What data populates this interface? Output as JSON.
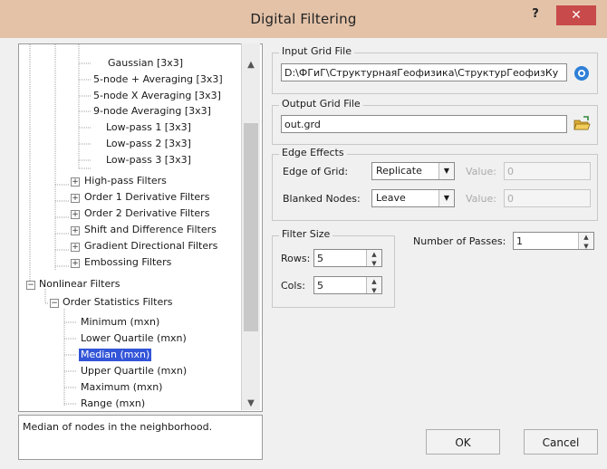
{
  "window": {
    "title": "Digital Filtering",
    "help_label": "?",
    "close_label": "✕"
  },
  "tree": {
    "items": [
      {
        "label": "Gaussian [3x3]"
      },
      {
        "label": "5-node + Averaging [3x3]"
      },
      {
        "label": "5-node X Averaging [3x3]"
      },
      {
        "label": "9-node Averaging [3x3]"
      },
      {
        "label": "Low-pass 1 [3x3]"
      },
      {
        "label": "Low-pass 2 [3x3]"
      },
      {
        "label": "Low-pass 3 [3x3]"
      },
      {
        "label": "High-pass Filters"
      },
      {
        "label": "Order 1 Derivative Filters"
      },
      {
        "label": "Order 2 Derivative Filters"
      },
      {
        "label": "Shift and Difference Filters"
      },
      {
        "label": "Gradient Directional Filters"
      },
      {
        "label": "Embossing Filters"
      },
      {
        "label": "Nonlinear Filters"
      },
      {
        "label": "Order Statistics Filters"
      },
      {
        "label": "Minimum (mxn)"
      },
      {
        "label": "Lower Quartile (mxn)"
      },
      {
        "label": "Median (mxn)"
      },
      {
        "label": "Upper Quartile (mxn)"
      },
      {
        "label": "Maximum (mxn)"
      },
      {
        "label": "Range (mxn)"
      }
    ],
    "selected": "Median (mxn)"
  },
  "description": "Median of nodes in the neighborhood.",
  "input_grid": {
    "label": "Input Grid File",
    "value": "D:\\ФГиГ\\СтруктурнаяГеофизика\\СтруктурГеофизКу"
  },
  "output_grid": {
    "label": "Output Grid File",
    "value": "out.grd"
  },
  "edge_effects": {
    "label": "Edge Effects",
    "edge_label": "Edge of Grid:",
    "edge_value": "Replicate",
    "edge_value_label": "Value:",
    "edge_value_value": "0",
    "blanked_label": "Blanked Nodes:",
    "blanked_value": "Leave",
    "blanked_value_label": "Value:",
    "blanked_value_value": "0"
  },
  "filter_size": {
    "label": "Filter Size",
    "rows_label": "Rows:",
    "rows_value": "5",
    "cols_label": "Cols:",
    "cols_value": "5"
  },
  "passes": {
    "label": "Number of Passes:",
    "value": "1"
  },
  "buttons": {
    "ok": "OK",
    "cancel": "Cancel"
  }
}
